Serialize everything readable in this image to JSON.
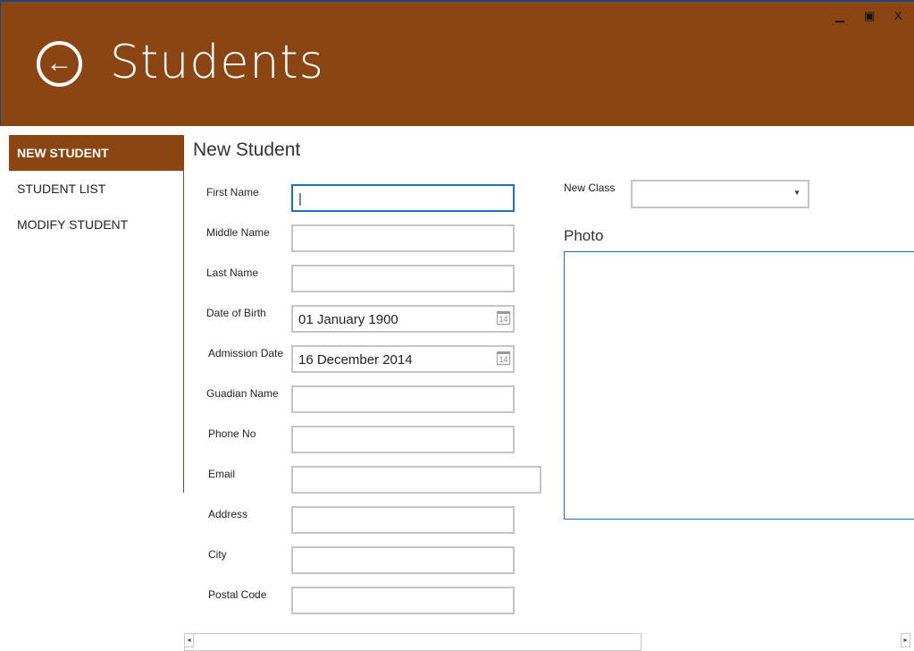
{
  "header": {
    "title": "Students",
    "minimize": "▁",
    "maximize": "▣",
    "close": "X"
  },
  "sidebar": {
    "items": [
      {
        "label": "NEW STUDENT"
      },
      {
        "label": "STUDENT LIST"
      },
      {
        "label": "MODIFY STUDENT"
      }
    ]
  },
  "form": {
    "title": "New Student",
    "fields": [
      {
        "label": "First Name",
        "value": "|"
      },
      {
        "label": "Middle Name",
        "value": ""
      },
      {
        "label": "Last Name",
        "value": ""
      },
      {
        "label": "Date of Birth",
        "value": "01 January 1900"
      },
      {
        "label": "Admission Date",
        "value": "16 December 2014"
      },
      {
        "label": "Guadian Name",
        "value": ""
      },
      {
        "label": "Phone No",
        "value": ""
      },
      {
        "label": "Email",
        "value": ""
      },
      {
        "label": "Address",
        "value": ""
      },
      {
        "label": "City",
        "value": ""
      },
      {
        "label": "Postal Code",
        "value": ""
      }
    ],
    "calendar_icon_text": "14",
    "new_class_label": "New Class",
    "new_class_value": "",
    "photo_label": "Photo"
  },
  "scroll": {
    "left": "◂",
    "right": "▸"
  },
  "colors": {
    "accent": "#8B4513",
    "focus": "#1f6fc0"
  }
}
